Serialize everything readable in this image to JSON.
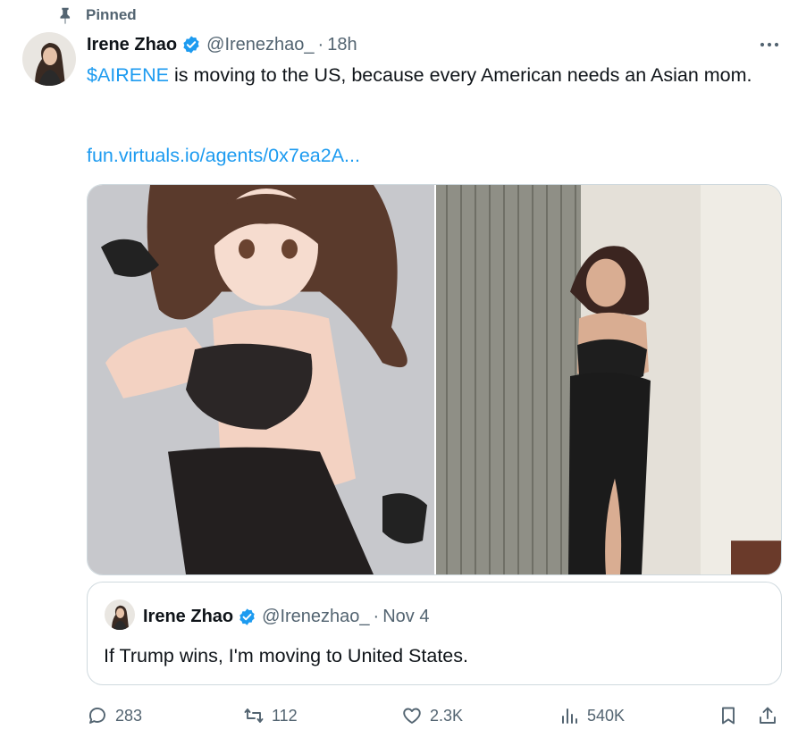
{
  "pinned": {
    "label": "Pinned",
    "icon": "pin-icon"
  },
  "tweet": {
    "author_name": "Irene Zhao",
    "handle": "@Irenezhao_",
    "separator": "·",
    "time": "18h",
    "cashtag": "$AIRENE",
    "text_rest": " is moving to the US, because every American needs an Asian mom.",
    "link": "fun.virtuals.io/agents/0x7ea2A...",
    "media": [
      "anime-illustration-image",
      "photo-image"
    ]
  },
  "quote": {
    "author_name": "Irene Zhao",
    "handle": "@Irenezhao_",
    "separator": "·",
    "time": "Nov 4",
    "text": "If Trump wins, I'm moving to United States."
  },
  "actions": {
    "replies": "283",
    "retweets": "112",
    "likes": "2.3K",
    "views": "540K"
  },
  "colors": {
    "accent": "#1d9bf0",
    "secondary_text": "#536471",
    "border": "#cfd9de"
  }
}
